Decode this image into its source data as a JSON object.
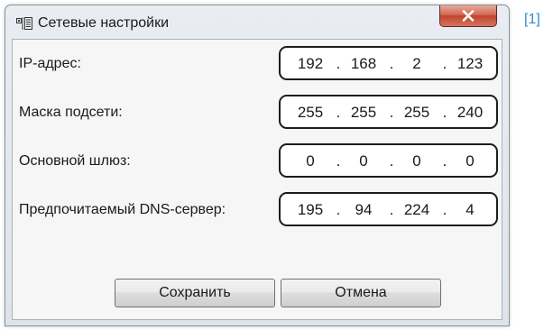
{
  "window": {
    "title": "Сетевые настройки",
    "close_glyph": "x"
  },
  "fields": [
    {
      "label": "IP-адрес:",
      "octets": [
        "192",
        "168",
        "2",
        "123"
      ]
    },
    {
      "label": "Маска подсети:",
      "octets": [
        "255",
        "255",
        "255",
        "240"
      ]
    },
    {
      "label": "Основной шлюз:",
      "octets": [
        "0",
        "0",
        "0",
        "0"
      ]
    },
    {
      "label": "Предпочитаемый DNS-сервер:",
      "octets": [
        "195",
        "94",
        "224",
        "4"
      ]
    }
  ],
  "octet_separator": ".",
  "buttons": {
    "save_label": "Сохранить",
    "cancel_label": "Отмена"
  },
  "footnote": "[1]",
  "colors": {
    "accent_close": "#c1432c",
    "footnote": "#2a8fd0"
  },
  "icons": {
    "window": "network-settings-icon",
    "close": "close-icon"
  }
}
